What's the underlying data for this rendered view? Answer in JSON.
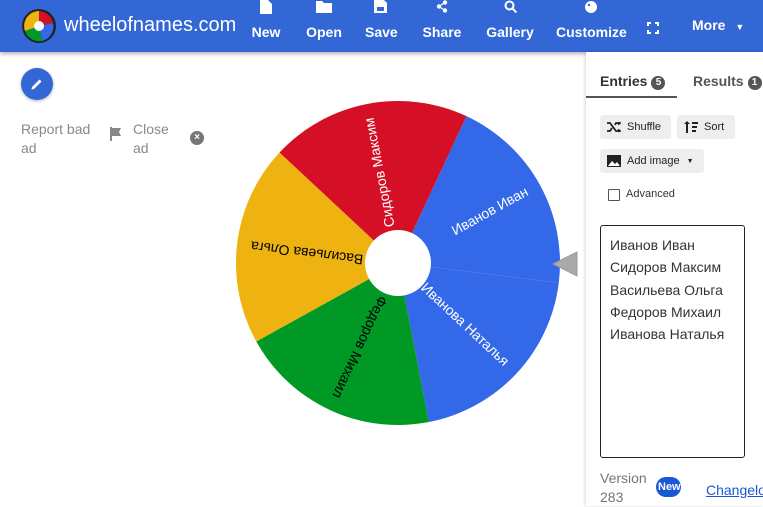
{
  "header": {
    "site_title": "wheelofnames.com",
    "nav": [
      {
        "label": "New",
        "icon": "new-file-icon"
      },
      {
        "label": "Open",
        "icon": "folder-icon"
      },
      {
        "label": "Save",
        "icon": "floppy-disk-icon"
      },
      {
        "label": "Share",
        "icon": "share-icon"
      },
      {
        "label": "Gallery",
        "icon": "search-icon"
      },
      {
        "label": "Customize",
        "icon": "palette-icon"
      },
      {
        "label": "",
        "icon": "fullscreen-icon"
      }
    ],
    "more_label": "More",
    "bar_color": "#3367d6"
  },
  "left": {
    "report_ad": "Report bad ad",
    "close_ad": "Close ad"
  },
  "wheel": {
    "segments": [
      {
        "name": "Иванов Иван",
        "color": "#3369e8"
      },
      {
        "name": "Иванова Наталья",
        "color": "#3369e8"
      },
      {
        "name": "Федоров Михаил",
        "color": "#009925"
      },
      {
        "name": "Васильева Ольга",
        "color": "#eeb211"
      },
      {
        "name": "Сидоров Максим",
        "color": "#d50f25"
      }
    ]
  },
  "panel": {
    "tabs": [
      {
        "label": "Entries",
        "count": "5"
      },
      {
        "label": "Results",
        "count": "1"
      }
    ],
    "shuffle_label": "Shuffle",
    "sort_label": "Sort",
    "add_image_label": "Add image",
    "advanced_label": "Advanced",
    "entries": [
      "Иванов Иван",
      "Сидоров Максим",
      "Васильева Ольга",
      "Федоров Михаил",
      "Иванова Наталья"
    ],
    "version_label": "Version 283",
    "new_badge": "New",
    "changelog_label": "Changelog"
  }
}
